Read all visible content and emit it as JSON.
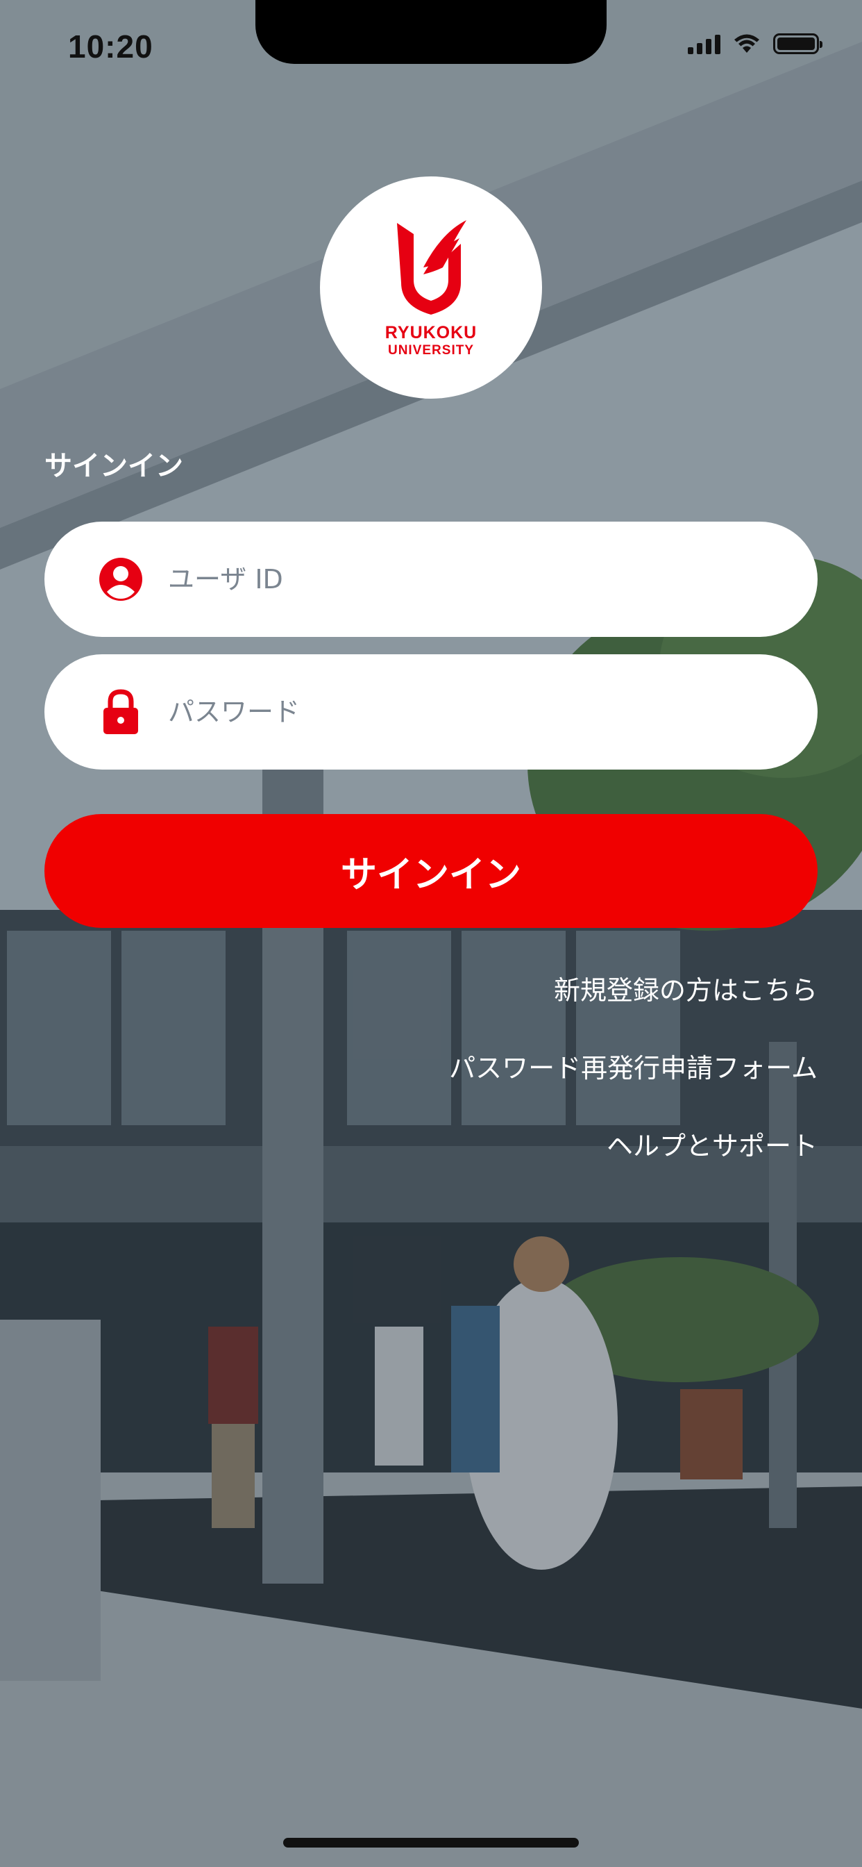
{
  "status_bar": {
    "time": "10:20"
  },
  "logo": {
    "line1": "RYUKOKU",
    "line2": "UNIVERSITY",
    "brand_color": "#e60012"
  },
  "signin": {
    "heading": "サインイン",
    "user_id_placeholder": "ユーザ ID",
    "password_placeholder": "パスワード",
    "button_label": "サインイン",
    "button_color": "#f00000"
  },
  "links": {
    "register": "新規登録の方はこちら",
    "password_reset": "パスワード再発行申請フォーム",
    "help": "ヘルプとサポート"
  },
  "icons": {
    "user": "user-circle-icon",
    "password": "lock-icon"
  }
}
